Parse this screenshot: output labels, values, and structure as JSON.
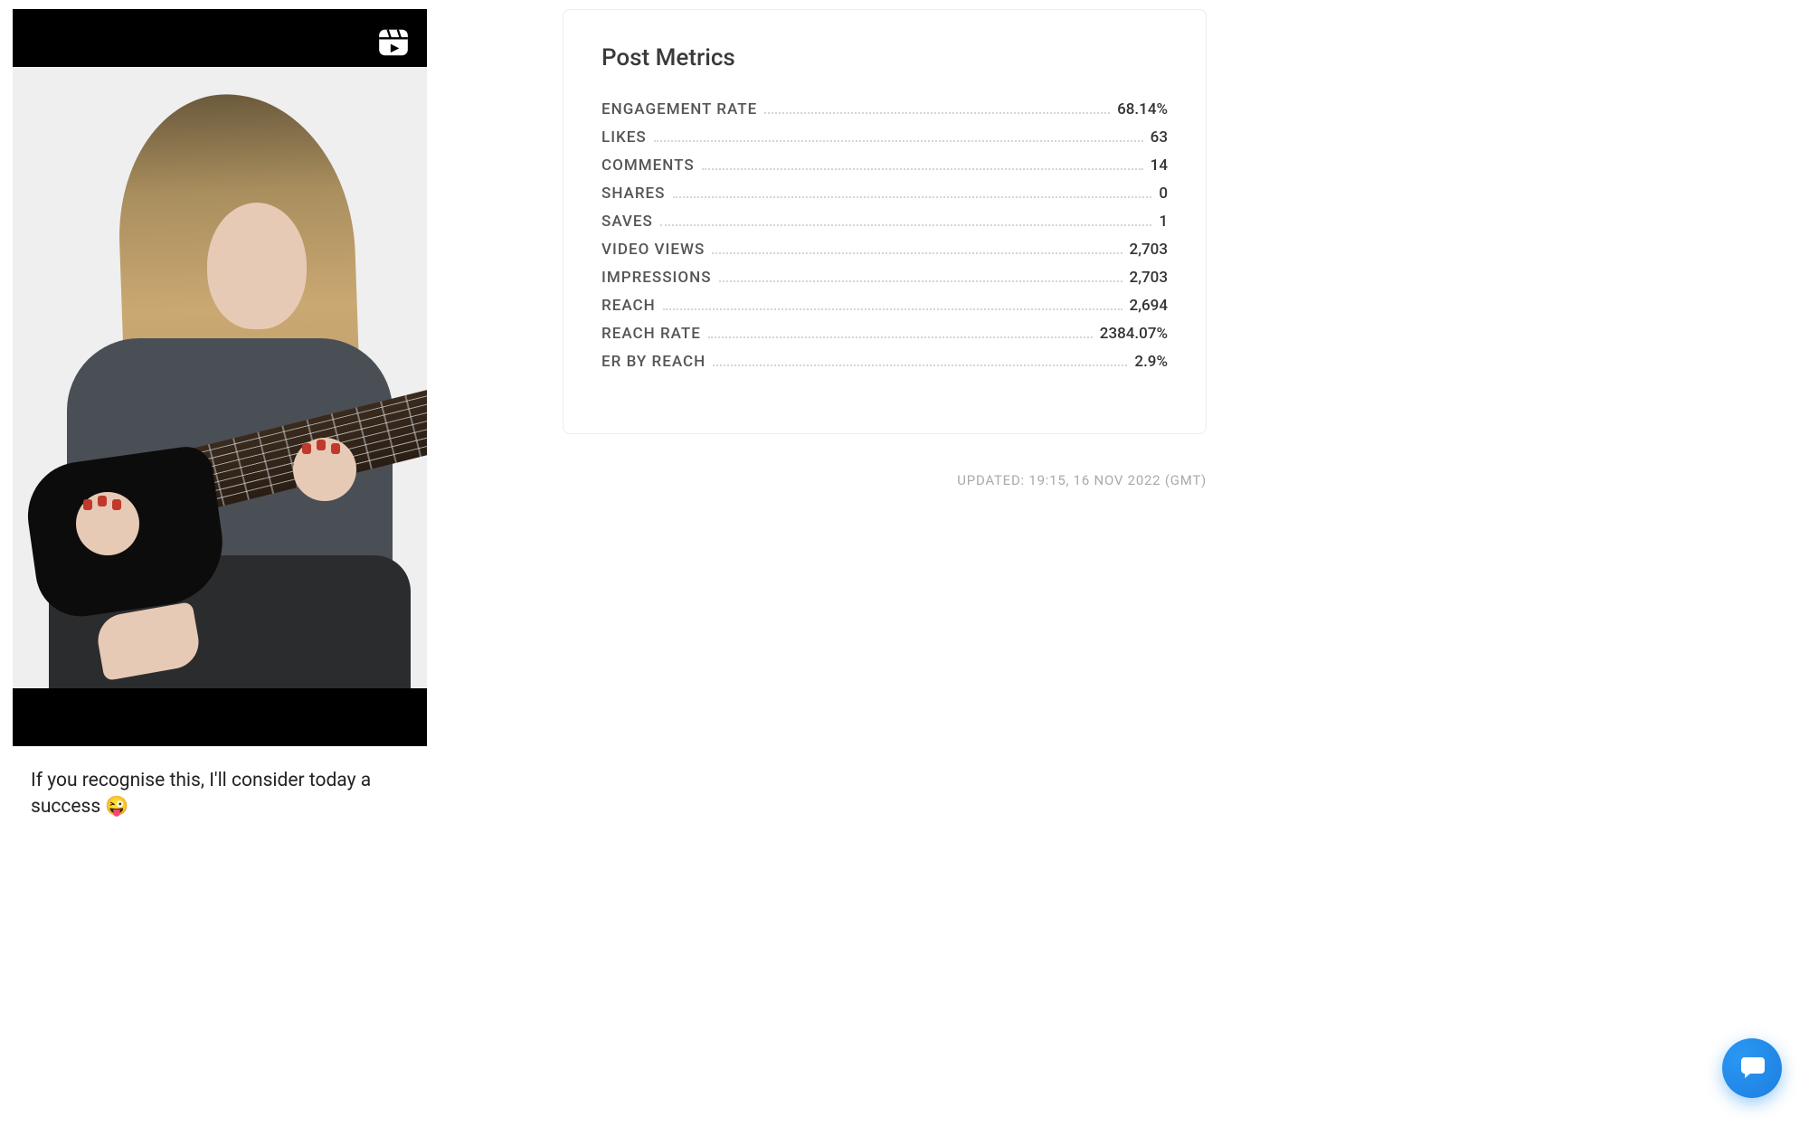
{
  "post": {
    "caption": "If you recognise this, I'll consider today a success 😜",
    "reel_icon_name": "reel-icon"
  },
  "metrics": {
    "title": "Post Metrics",
    "rows": [
      {
        "label": "ENGAGEMENT RATE",
        "value": "68.14%"
      },
      {
        "label": "LIKES",
        "value": "63"
      },
      {
        "label": "COMMENTS",
        "value": "14"
      },
      {
        "label": "SHARES",
        "value": "0"
      },
      {
        "label": "SAVES",
        "value": "1"
      },
      {
        "label": "VIDEO VIEWS",
        "value": "2,703"
      },
      {
        "label": "IMPRESSIONS",
        "value": "2,703"
      },
      {
        "label": "REACH",
        "value": "2,694"
      },
      {
        "label": "REACH RATE",
        "value": "2384.07%"
      },
      {
        "label": "ER BY REACH",
        "value": "2.9%"
      }
    ]
  },
  "updated": "Updated: 19:15, 16 Nov 2022 (GMT)",
  "chat_icon_name": "chat-icon"
}
